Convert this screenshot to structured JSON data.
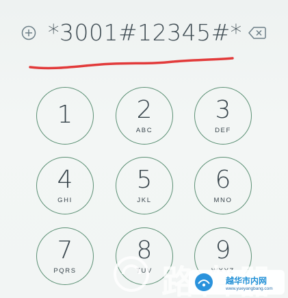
{
  "dialer": {
    "entered_code": "*3001#12345#*",
    "add_icon": "plus-circle-icon",
    "delete_icon": "backspace-icon",
    "annotation_color": "#e23a3a"
  },
  "keypad": [
    {
      "digit": "1",
      "letters": ""
    },
    {
      "digit": "2",
      "letters": "ABC"
    },
    {
      "digit": "3",
      "letters": "DEF"
    },
    {
      "digit": "4",
      "letters": "GHI"
    },
    {
      "digit": "5",
      "letters": "JKL"
    },
    {
      "digit": "6",
      "letters": "MNO"
    },
    {
      "digit": "7",
      "letters": "PQRS"
    },
    {
      "digit": "8",
      "letters": "TUV"
    },
    {
      "digit": "9",
      "letters": "WXYZ"
    }
  ],
  "colors": {
    "key_ring": "#5a8f73",
    "text": "#36434a",
    "icons": "#6b7d86"
  },
  "watermark": {
    "large_text": "路由器",
    "site_name": "越华市内网",
    "site_url": "www.yueyangbang.com"
  }
}
